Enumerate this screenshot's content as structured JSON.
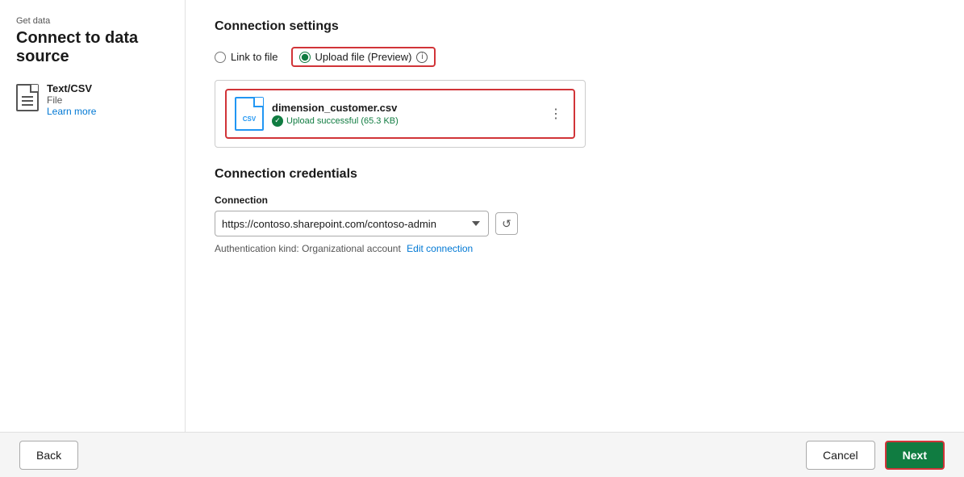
{
  "breadcrumb": "Get data",
  "page_title": "Connect to data source",
  "sidebar": {
    "file_icon_alt": "file-icon",
    "item_name": "Text/CSV",
    "item_type": "File",
    "learn_more_label": "Learn more"
  },
  "connection_settings": {
    "section_title": "Connection settings",
    "radio_link_label": "Link to file",
    "radio_upload_label": "Upload file (Preview)",
    "info_icon_label": "ⓘ",
    "file": {
      "name": "dimension_customer.csv",
      "status": "Upload successful (65.3 KB)"
    },
    "more_options_label": "⋮"
  },
  "connection_credentials": {
    "section_title": "Connection credentials",
    "connection_label": "Connection",
    "connection_value": "https://contoso.sharepoint.com/contoso-admin",
    "auth_text": "Authentication kind: Organizational account",
    "edit_connection_label": "Edit connection",
    "refresh_icon": "↺"
  },
  "footer": {
    "back_label": "Back",
    "cancel_label": "Cancel",
    "next_label": "Next"
  }
}
